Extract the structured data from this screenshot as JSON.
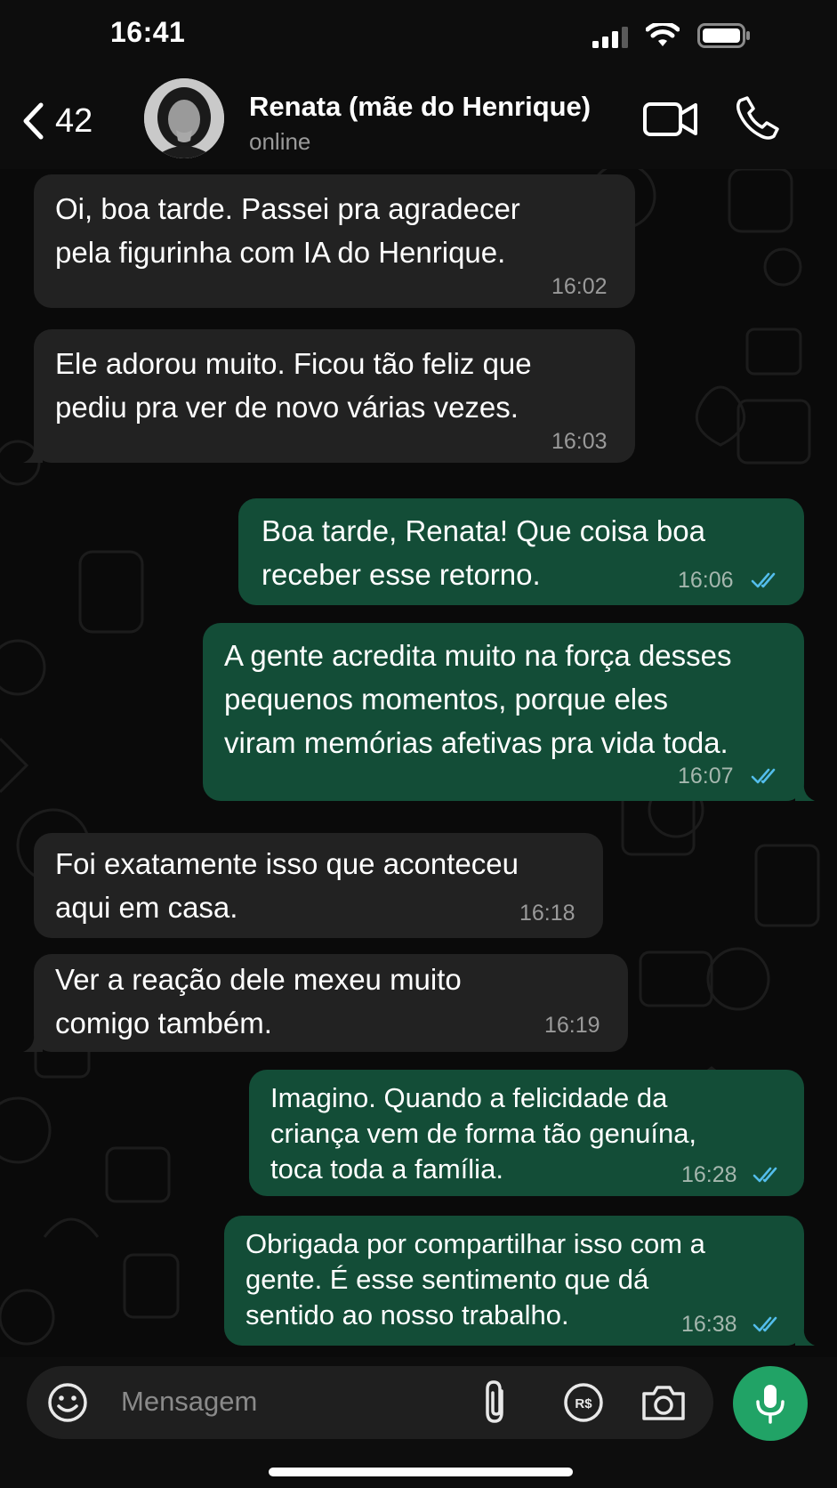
{
  "status_bar": {
    "time": "16:41"
  },
  "header": {
    "back_count": "42",
    "contact_name": "Renata (mãe do Henrique)",
    "contact_status": "online"
  },
  "messages": [
    {
      "direction": "in",
      "text": "Oi, boa tarde. Passei pra agradecer\npela figurinha com IA do Henrique.",
      "time": "16:02"
    },
    {
      "direction": "in",
      "text": "Ele adorou muito. Ficou tão feliz que\npediu pra ver de novo várias vezes.",
      "time": "16:03"
    },
    {
      "direction": "out",
      "text": "Boa tarde, Renata! Que coisa boa\nreceber esse retorno.",
      "time": "16:06",
      "status": "read"
    },
    {
      "direction": "out",
      "text": "A gente acredita muito na força desses\npequenos momentos, porque eles\nviram memórias afetivas pra vida toda.",
      "time": "16:07",
      "status": "read"
    },
    {
      "direction": "in",
      "text": "Foi exatamente isso que aconteceu\naqui em casa.",
      "time": "16:18"
    },
    {
      "direction": "in",
      "text": "Ver a reação dele mexeu muito\ncomigo também.",
      "time": "16:19"
    },
    {
      "direction": "out",
      "text": "Imagino. Quando a felicidade da\ncriança vem de forma tão genuína,\ntoca toda a família.",
      "time": "16:28",
      "status": "read"
    },
    {
      "direction": "out",
      "text": "Obrigada por compartilhar isso com a\ngente. É esse sentimento que dá\nsentido ao nosso trabalho.",
      "time": "16:38",
      "status": "read"
    }
  ],
  "composer": {
    "placeholder": "Mensagem"
  },
  "colors": {
    "incoming_bubble": "#222222",
    "outgoing_bubble": "#134d37",
    "read_ticks": "#53bdeb",
    "mic_button": "#21a366"
  },
  "icons": {
    "back": "chevron-left-icon",
    "video": "video-camera-icon",
    "call": "phone-icon",
    "emoji": "smiley-icon",
    "attach": "paperclip-icon",
    "payment": "pix-payment-icon",
    "camera": "camera-icon",
    "mic": "microphone-icon",
    "read": "double-check-icon"
  }
}
